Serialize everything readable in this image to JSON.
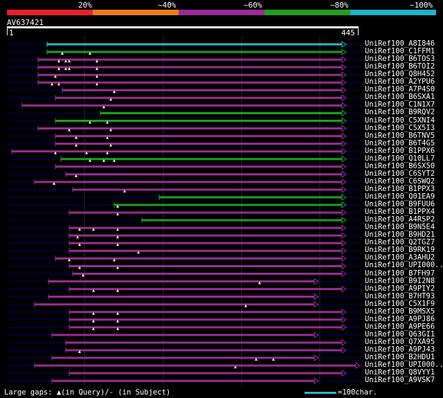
{
  "legend": {
    "segments": [
      {
        "label": "20%",
        "color": "#e8202a"
      },
      {
        "label": "~40%",
        "color": "#ea7d22"
      },
      {
        "label": "~60%",
        "color": "#9b2c96"
      },
      {
        "label": "~80%",
        "color": "#1fa01f"
      },
      {
        "label": "~100%",
        "color": "#1fb3c3"
      }
    ]
  },
  "query": {
    "id": "AV637421",
    "start": "1",
    "end": "445",
    "length": 445
  },
  "colors": {
    "cyan": "#2cb8c8",
    "green": "#1fa01f",
    "purple": "#9b2c96",
    "navy": "#000040",
    "grid": "#2a2a2a"
  },
  "hits": [
    {
      "name": "UniRef100_A8I846",
      "color": "cyan",
      "start": 68,
      "end": 500,
      "marks": []
    },
    {
      "name": "UniRef100_C1FFM1",
      "color": "green",
      "start": 68,
      "end": 500,
      "marks": [
        90,
        130
      ]
    },
    {
      "name": "UniRef100_B6TOS3",
      "color": "purple",
      "start": 55,
      "end": 500,
      "marks": [
        85,
        95,
        100,
        140
      ]
    },
    {
      "name": "UniRef100_B6TOI2",
      "color": "purple",
      "start": 55,
      "end": 500,
      "marks": [
        85,
        95,
        100,
        140
      ]
    },
    {
      "name": "UniRef100_Q8H452",
      "color": "purple",
      "start": 55,
      "end": 500,
      "marks": [
        80,
        140
      ]
    },
    {
      "name": "UniRef100_A2YPU6",
      "color": "purple",
      "start": 55,
      "end": 500,
      "marks": [
        75,
        85,
        140
      ]
    },
    {
      "name": "UniRef100_A7P4S0",
      "color": "purple",
      "start": 90,
      "end": 500,
      "marks": [
        165
      ]
    },
    {
      "name": "UniRef100_B6SXA1",
      "color": "purple",
      "start": 80,
      "end": 500,
      "marks": [
        160
      ]
    },
    {
      "name": "UniRef100_C1N1X7",
      "color": "purple",
      "start": 32,
      "end": 500,
      "marks": [
        150
      ]
    },
    {
      "name": "UniRef100_B9RQV2",
      "color": "green",
      "start": 145,
      "end": 500,
      "marks": []
    },
    {
      "name": "UniRef100_C5XNI4",
      "color": "green",
      "start": 80,
      "end": 500,
      "marks": [
        130,
        155
      ]
    },
    {
      "name": "UniRef100_C5X5I3",
      "color": "purple",
      "start": 55,
      "end": 500,
      "marks": [
        100,
        160
      ]
    },
    {
      "name": "UniRef100_B6TNV5",
      "color": "purple",
      "start": 80,
      "end": 500,
      "marks": [
        110,
        155
      ]
    },
    {
      "name": "UniRef100_B6T4G5",
      "color": "purple",
      "start": 80,
      "end": 500,
      "marks": [
        110,
        160
      ]
    },
    {
      "name": "UniRef100_B1PPX6",
      "color": "purple",
      "start": 17,
      "end": 500,
      "marks": [
        80,
        125,
        155
      ]
    },
    {
      "name": "UniRef100_Q10LL7",
      "color": "green",
      "start": 88,
      "end": 500,
      "marks": [
        130,
        150,
        165
      ]
    },
    {
      "name": "UniRef100_B6SX50",
      "color": "purple",
      "start": 80,
      "end": 500,
      "marks": []
    },
    {
      "name": "UniRef100_C6SYT2",
      "color": "purple",
      "start": 95,
      "end": 500,
      "marks": [
        110
      ]
    },
    {
      "name": "UniRef100_C6SWQ2",
      "color": "purple",
      "start": 50,
      "end": 500,
      "marks": [
        78
      ]
    },
    {
      "name": "UniRef100_B1PPX3",
      "color": "purple",
      "start": 105,
      "end": 500,
      "marks": [
        180
      ]
    },
    {
      "name": "UniRef100_Q01EA9",
      "color": "green",
      "start": 230,
      "end": 500,
      "marks": []
    },
    {
      "name": "UniRef100_B9FUU6",
      "color": "green",
      "start": 165,
      "end": 500,
      "marks": [
        170
      ]
    },
    {
      "name": "UniRef100_B1PPX4",
      "color": "purple",
      "start": 100,
      "end": 500,
      "marks": [
        170
      ]
    },
    {
      "name": "UniRef100_A4RSP2",
      "color": "green",
      "start": 205,
      "end": 500,
      "marks": []
    },
    {
      "name": "UniRef100_B9N5E4",
      "color": "purple",
      "start": 100,
      "end": 500,
      "marks": [
        115,
        135,
        170
      ]
    },
    {
      "name": "UniRef100_B9HD21",
      "color": "purple",
      "start": 100,
      "end": 500,
      "marks": [
        112,
        170
      ]
    },
    {
      "name": "UniRef100_Q2TGZ7",
      "color": "purple",
      "start": 100,
      "end": 500,
      "marks": [
        115,
        170
      ]
    },
    {
      "name": "UniRef100_B9RK19",
      "color": "purple",
      "start": 100,
      "end": 500,
      "marks": [
        200
      ]
    },
    {
      "name": "UniRef100_A3AHU2",
      "color": "purple",
      "start": 80,
      "end": 500,
      "marks": [
        100,
        165
      ]
    },
    {
      "name": "UniRef100_UPI000..",
      "color": "purple",
      "start": 100,
      "end": 500,
      "marks": [
        115,
        170
      ]
    },
    {
      "name": "UniRef100_B7FH97",
      "color": "purple",
      "start": 105,
      "end": 500,
      "marks": [
        120
      ]
    },
    {
      "name": "UniRef100_B9I2N8",
      "color": "purple",
      "start": 70,
      "end": 460,
      "marks": [
        375
      ]
    },
    {
      "name": "UniRef100_A9PIY2",
      "color": "purple",
      "start": 100,
      "end": 500,
      "marks": [
        135,
        170
      ]
    },
    {
      "name": "UniRef100_B7HT93",
      "color": "purple",
      "start": 70,
      "end": 460,
      "marks": []
    },
    {
      "name": "UniRef100_C5X1F9",
      "color": "purple",
      "start": 50,
      "end": 460,
      "marks": [
        355
      ]
    },
    {
      "name": "UniRef100_B9MSX5",
      "color": "purple",
      "start": 100,
      "end": 500,
      "marks": [
        135,
        170
      ]
    },
    {
      "name": "UniRef100_A9PJ86",
      "color": "purple",
      "start": 100,
      "end": 500,
      "marks": [
        135,
        170
      ]
    },
    {
      "name": "UniRef100_A9PE66",
      "color": "purple",
      "start": 100,
      "end": 500,
      "marks": [
        135,
        170
      ]
    },
    {
      "name": "UniRef100_Q63GI1",
      "color": "purple",
      "start": 75,
      "end": 460,
      "marks": []
    },
    {
      "name": "UniRef100_Q7XA95",
      "color": "purple",
      "start": 95,
      "end": 500,
      "marks": []
    },
    {
      "name": "UniRef100_A9PJ43",
      "color": "purple",
      "start": 95,
      "end": 500,
      "marks": [
        115
      ]
    },
    {
      "name": "UniRef100_B2HDU1",
      "color": "purple",
      "start": 75,
      "end": 460,
      "marks": [
        370,
        395
      ]
    },
    {
      "name": "UniRef100_UPI000..",
      "color": "purple",
      "start": 50,
      "end": 520,
      "marks": [
        340
      ]
    },
    {
      "name": "UniRef100_Q8VYY1",
      "color": "purple",
      "start": 100,
      "end": 500,
      "marks": []
    },
    {
      "name": "UniRef100_A9VSK7",
      "color": "purple",
      "start": 75,
      "end": 460,
      "marks": []
    }
  ],
  "footer": {
    "gaps_text": "Large gaps: ▲(in Query)/- (in Subject)",
    "scale_label": "=100char."
  }
}
